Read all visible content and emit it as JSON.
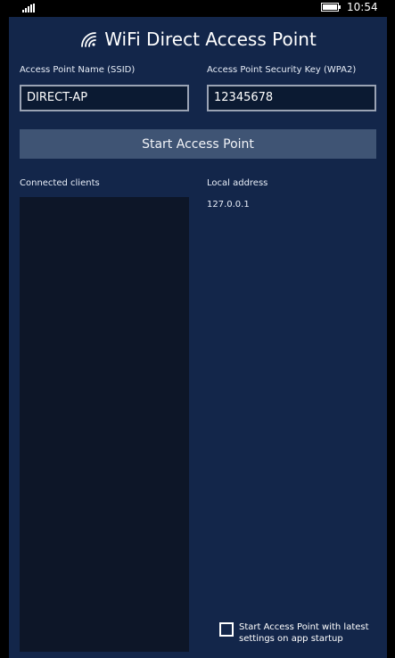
{
  "status_bar": {
    "time": "10:54"
  },
  "app": {
    "title": "WiFi Direct Access Point",
    "ssid": {
      "label": "Access Point Name (SSID)",
      "value": "DIRECT-AP"
    },
    "key": {
      "label": "Access Point Security Key (WPA2)",
      "value": "12345678"
    },
    "start_button_label": "Start Access Point",
    "connected_clients": {
      "label": "Connected clients",
      "items": []
    },
    "local_address": {
      "label": "Local address",
      "value": "127.0.0.1"
    },
    "startup_checkbox": {
      "label": "Start Access Point with latest settings on app startup",
      "checked": false
    }
  },
  "colors": {
    "app_background": "#13264a",
    "button_background": "#3f5474",
    "list_background": "#0d1628",
    "field_border": "#9aa3b4"
  }
}
